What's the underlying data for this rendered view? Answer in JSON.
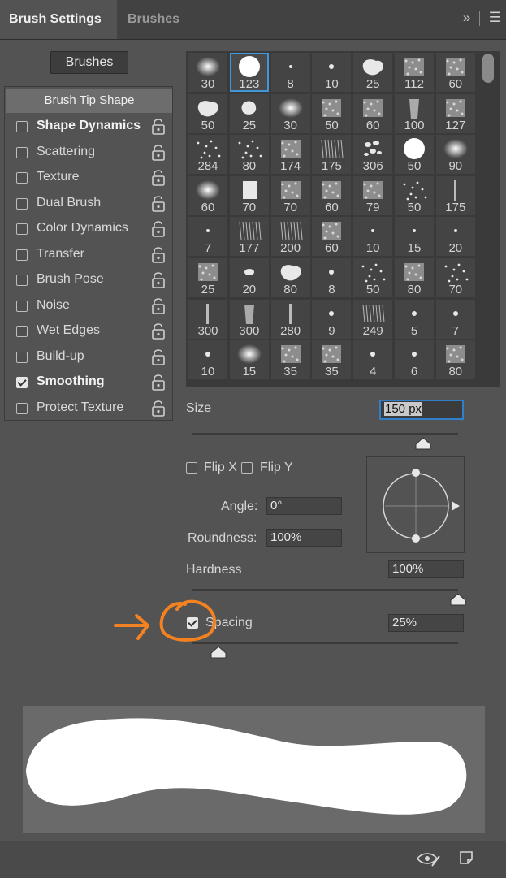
{
  "tabs": {
    "active": "Brush Settings",
    "inactive": "Brushes"
  },
  "header_icons": {
    "expand": "collapse-arrows-icon",
    "menu": "panel-menu-icon"
  },
  "brushes_button": "Brushes",
  "brush_tip_shape": "Brush Tip Shape",
  "options": [
    {
      "label": "Shape Dynamics",
      "checked": false,
      "bold": true
    },
    {
      "label": "Scattering",
      "checked": false,
      "bold": false
    },
    {
      "label": "Texture",
      "checked": false,
      "bold": false
    },
    {
      "label": "Dual Brush",
      "checked": false,
      "bold": false
    },
    {
      "label": "Color Dynamics",
      "checked": false,
      "bold": false
    },
    {
      "label": "Transfer",
      "checked": false,
      "bold": false
    },
    {
      "label": "Brush Pose",
      "checked": false,
      "bold": false
    },
    {
      "label": "Noise",
      "checked": false,
      "bold": false
    },
    {
      "label": "Wet Edges",
      "checked": false,
      "bold": false
    },
    {
      "label": "Build-up",
      "checked": false,
      "bold": false
    },
    {
      "label": "Smoothing",
      "checked": true,
      "bold": true
    },
    {
      "label": "Protect Texture",
      "checked": false,
      "bold": false
    }
  ],
  "brush_sizes": [
    [
      "30",
      "123",
      "8",
      "10",
      "25",
      "112",
      "60"
    ],
    [
      "50",
      "25",
      "30",
      "50",
      "60",
      "100",
      "127"
    ],
    [
      "284",
      "80",
      "174",
      "175",
      "306",
      "50",
      "90"
    ],
    [
      "60",
      "70",
      "70",
      "60",
      "79",
      "50",
      "175"
    ],
    [
      "7",
      "177",
      "200",
      "60",
      "10",
      "15",
      "20"
    ],
    [
      "25",
      "20",
      "80",
      "8",
      "50",
      "80",
      "70"
    ],
    [
      "300",
      "300",
      "280",
      "9",
      "249",
      "5",
      "7"
    ],
    [
      "10",
      "15",
      "35",
      "35",
      "4",
      "6",
      "80"
    ]
  ],
  "brush_shapes": [
    [
      "soft",
      "round",
      "tiny",
      "dot",
      "splat",
      "texture",
      "texture"
    ],
    [
      "splat",
      "blob",
      "soft",
      "texture",
      "texture",
      "hair",
      "texture"
    ],
    [
      "scatter",
      "scatter",
      "texture",
      "grass",
      "leaves",
      "round",
      "soft"
    ],
    [
      "soft",
      "square",
      "texture",
      "texture",
      "texture",
      "scatter",
      "line"
    ],
    [
      "tiny",
      "grass",
      "grass",
      "texture",
      "tiny",
      "tiny",
      "tiny"
    ],
    [
      "texture",
      "ellipse",
      "splat",
      "dot",
      "scatter",
      "texture",
      "scatter"
    ],
    [
      "line",
      "hair",
      "line",
      "dot",
      "grass",
      "dot",
      "dot"
    ],
    [
      "dot",
      "soft",
      "texture",
      "texture",
      "dot",
      "dot",
      "texture"
    ]
  ],
  "selected_brush": {
    "row": 0,
    "col": 1
  },
  "size": {
    "label": "Size",
    "value": "150 px",
    "slider": 0.87
  },
  "flip_x": {
    "label": "Flip X",
    "checked": false
  },
  "flip_y": {
    "label": "Flip Y",
    "checked": false
  },
  "angle": {
    "label": "Angle:",
    "value": "0°"
  },
  "roundness": {
    "label": "Roundness:",
    "value": "100%"
  },
  "hardness": {
    "label": "Hardness",
    "value": "100%",
    "slider": 1.0
  },
  "spacing": {
    "label": "Spacing",
    "value": "25%",
    "checked": true,
    "slider": 0.1
  },
  "annotation": {
    "color": "#f58220"
  },
  "footer_icons": {
    "left": "eye-brush-icon",
    "right": "new-preset-icon"
  }
}
